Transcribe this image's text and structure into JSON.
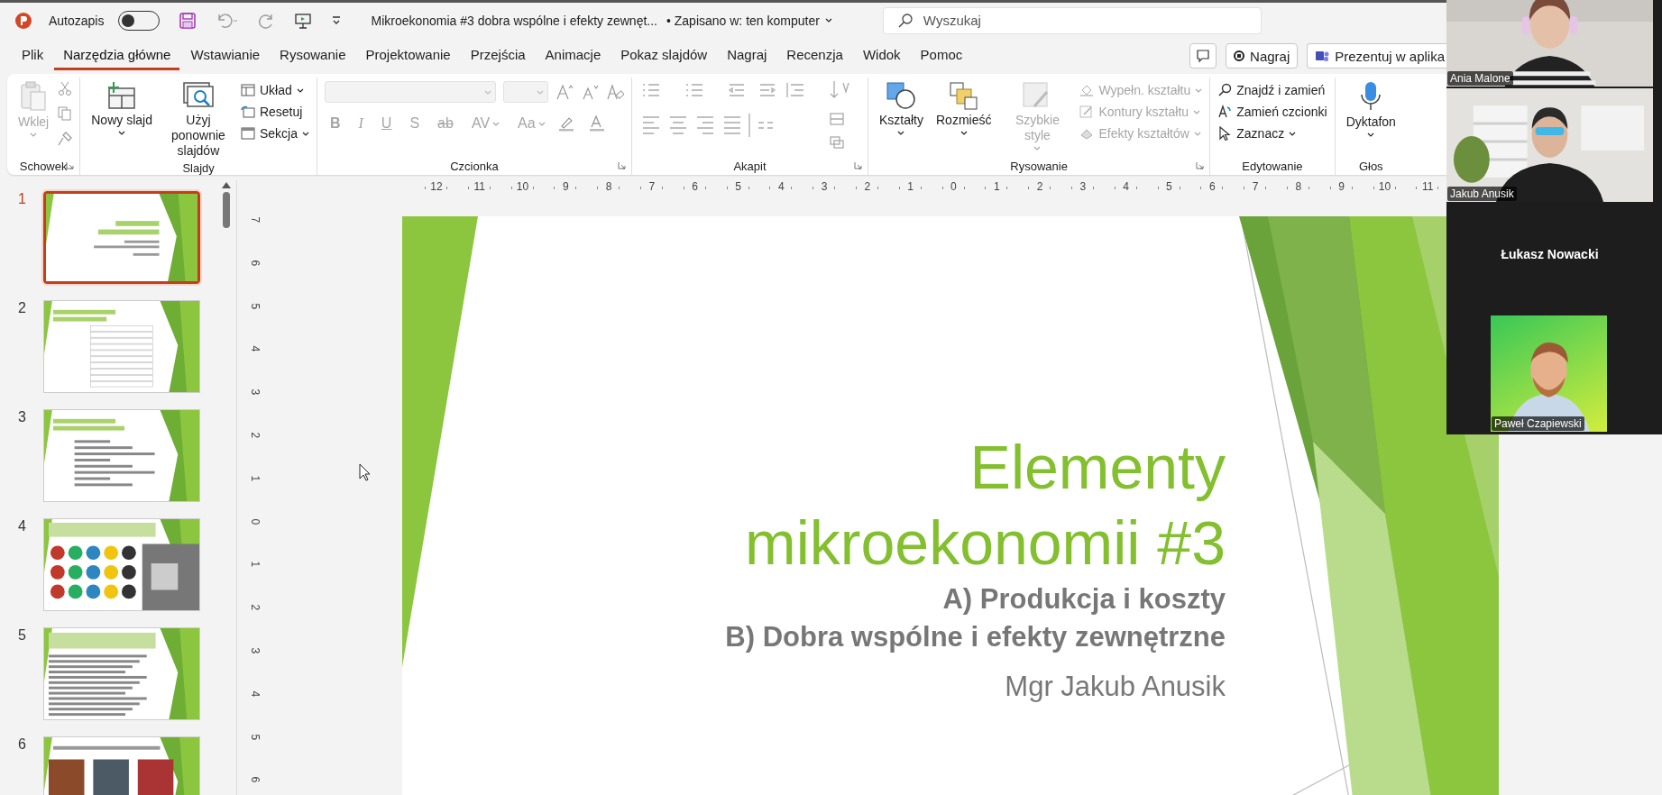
{
  "title_bar": {
    "autosave_label": "Autozapis",
    "autosave_on": false,
    "document_title": "Mikroekonomia #3 dobra wspólne i efekty zewnęt...",
    "save_status": "• Zapisano w: ten komputer",
    "search_placeholder": "Wyszukaj"
  },
  "menu_tabs": [
    {
      "label": "Plik",
      "selected": false
    },
    {
      "label": "Narzędzia główne",
      "selected": true
    },
    {
      "label": "Wstawianie",
      "selected": false
    },
    {
      "label": "Rysowanie",
      "selected": false
    },
    {
      "label": "Projektowanie",
      "selected": false
    },
    {
      "label": "Przejścia",
      "selected": false
    },
    {
      "label": "Animacje",
      "selected": false
    },
    {
      "label": "Pokaz slajdów",
      "selected": false
    },
    {
      "label": "Nagraj",
      "selected": false
    },
    {
      "label": "Recenzja",
      "selected": false
    },
    {
      "label": "Widok",
      "selected": false
    },
    {
      "label": "Pomoc",
      "selected": false
    }
  ],
  "tab_actions": [
    {
      "label": "Nagraj",
      "kind": "record"
    },
    {
      "label": "Prezentuj w aplika",
      "kind": "present"
    }
  ],
  "ribbon": [
    {
      "name": "Schowek",
      "kind": "clipboard",
      "items": [
        {
          "label": "Wklej",
          "disabled": true,
          "dropdown": true
        }
      ]
    },
    {
      "name": "Slajdy",
      "kind": "slides",
      "items": [
        {
          "label": "Nowy slajd",
          "kind": "large",
          "disabled": false,
          "dropdown": true
        },
        {
          "label": "Użyj ponownie slajdów",
          "kind": "large",
          "disabled": false,
          "dropdown": false
        },
        {
          "label": "Układ",
          "kind": "small",
          "disabled": false,
          "dropdown": true
        },
        {
          "label": "Resetuj",
          "kind": "small",
          "disabled": false,
          "dropdown": false
        },
        {
          "label": "Sekcja",
          "kind": "small",
          "disabled": false,
          "dropdown": true
        }
      ]
    },
    {
      "name": "Czcionka",
      "kind": "font",
      "items": [
        {
          "label": "B",
          "disabled": true,
          "dropdown": false
        },
        {
          "label": "I",
          "disabled": true,
          "dropdown": false
        },
        {
          "label": "U",
          "disabled": true,
          "dropdown": false
        },
        {
          "label": "S",
          "disabled": true,
          "dropdown": false
        },
        {
          "label": "ab",
          "disabled": true,
          "dropdown": false
        },
        {
          "label": "AV",
          "disabled": true,
          "dropdown": true
        },
        {
          "label": "Aa",
          "disabled": true,
          "dropdown": true
        }
      ]
    },
    {
      "name": "Akapit",
      "kind": "paragraph"
    },
    {
      "name": "Rysowanie",
      "kind": "drawing",
      "items": [
        {
          "label": "Kształty",
          "kind": "large",
          "disabled": false,
          "dropdown": true
        },
        {
          "label": "Rozmieść",
          "kind": "large",
          "disabled": false,
          "dropdown": true
        },
        {
          "label": "Szybkie style",
          "kind": "large",
          "disabled": true,
          "dropdown": true
        },
        {
          "label": "Wypełn. kształtu",
          "kind": "small",
          "disabled": true,
          "dropdown": true
        },
        {
          "label": "Kontury kształtu",
          "kind": "small",
          "disabled": true,
          "dropdown": true
        },
        {
          "label": "Efekty kształtów",
          "kind": "small",
          "disabled": true,
          "dropdown": true
        }
      ]
    },
    {
      "name": "Edytowanie",
      "kind": "editing",
      "items": [
        {
          "label": "Znajdź i zamień",
          "kind": "small",
          "disabled": false,
          "dropdown": false
        },
        {
          "label": "Zamień czcionki",
          "kind": "small",
          "disabled": false,
          "dropdown": false
        },
        {
          "label": "Zaznacz",
          "kind": "small",
          "disabled": false,
          "dropdown": true
        }
      ]
    },
    {
      "name": "Głos",
      "kind": "voice",
      "items": [
        {
          "label": "Dyktafon",
          "kind": "large",
          "disabled": false,
          "dropdown": true
        }
      ]
    }
  ],
  "horizontal_ruler": [
    "12",
    "11",
    "10",
    "9",
    "8",
    "7",
    "6",
    "5",
    "4",
    "3",
    "2",
    "1",
    "0",
    "1",
    "2",
    "3",
    "4",
    "5",
    "6",
    "7",
    "8",
    "9",
    "10",
    "11"
  ],
  "vertical_ruler": [
    "7",
    "6",
    "5",
    "4",
    "3",
    "2",
    "1",
    "0",
    "1",
    "2",
    "3",
    "4",
    "5",
    "6"
  ],
  "slides": [
    {
      "number": "1",
      "selected": true,
      "kind": "title"
    },
    {
      "number": "2",
      "selected": false,
      "kind": "table"
    },
    {
      "number": "3",
      "selected": false,
      "kind": "list"
    },
    {
      "number": "4",
      "selected": false,
      "kind": "images"
    },
    {
      "number": "5",
      "selected": false,
      "kind": "text"
    },
    {
      "number": "6",
      "selected": false,
      "kind": "gallery"
    }
  ],
  "slide": {
    "title_lines": [
      "Elementy",
      "mikroekonomii #3"
    ],
    "subtitle_lines": [
      "A) Produkcja i koszty",
      "B) Dobra wspólne i efekty zewnętrzne"
    ],
    "author": "Mgr Jakub Anusik"
  },
  "participants": [
    {
      "name": "Ania Malone",
      "kind": "video"
    },
    {
      "name": "Jakub Anusik",
      "kind": "video"
    },
    {
      "name": "Łukasz Nowacki",
      "kind": "name_only"
    },
    {
      "name": "Paweł Czapiewski",
      "kind": "avatar"
    }
  ]
}
